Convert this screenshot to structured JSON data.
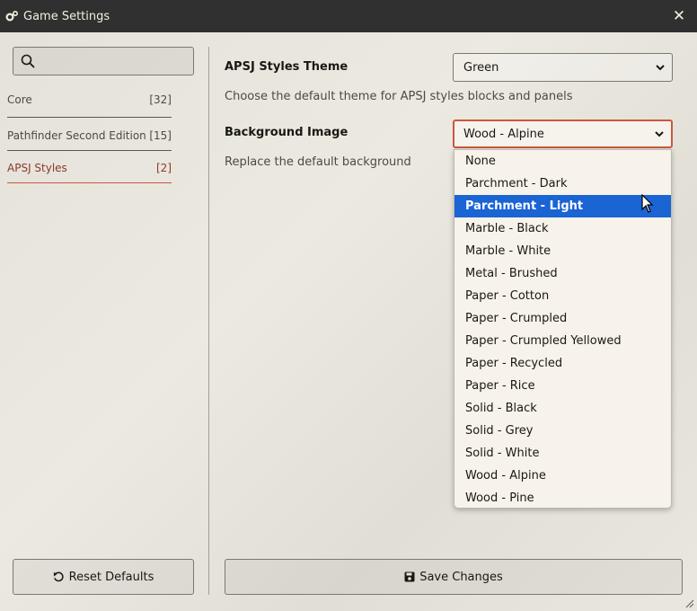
{
  "window": {
    "title": "Game Settings",
    "close_icon": "close-icon",
    "gear_icon": "gears-icon"
  },
  "sidebar": {
    "search": {
      "value": "",
      "placeholder": ""
    },
    "categories": [
      {
        "label": "Core",
        "count": "[32]"
      },
      {
        "label": "Pathfinder Second Edition",
        "count": "[15]"
      },
      {
        "label": "APSJ Styles",
        "count": "[2]",
        "active": true
      }
    ],
    "reset_label": "Reset Defaults"
  },
  "settings": {
    "theme": {
      "label": "APSJ Styles Theme",
      "value": "Green",
      "hint": "Choose the default theme for APSJ styles blocks and panels"
    },
    "background": {
      "label": "Background Image",
      "value": "Wood - Alpine",
      "hint": "Replace the default background",
      "options": [
        "None",
        "Parchment - Dark",
        "Parchment - Light",
        "Marble - Black",
        "Marble - White",
        "Metal - Brushed",
        "Paper - Cotton",
        "Paper - Crumpled",
        "Paper - Crumpled Yellowed",
        "Paper - Recycled",
        "Paper - Rice",
        "Solid - Black",
        "Solid - Grey",
        "Solid - White",
        "Wood - Alpine",
        "Wood - Pine"
      ],
      "highlighted": "Parchment - Light"
    }
  },
  "footer": {
    "save_label": "Save Changes"
  },
  "colors": {
    "accent": "#c9593f",
    "highlight": "#1a64d4",
    "titlebar": "#303030"
  }
}
